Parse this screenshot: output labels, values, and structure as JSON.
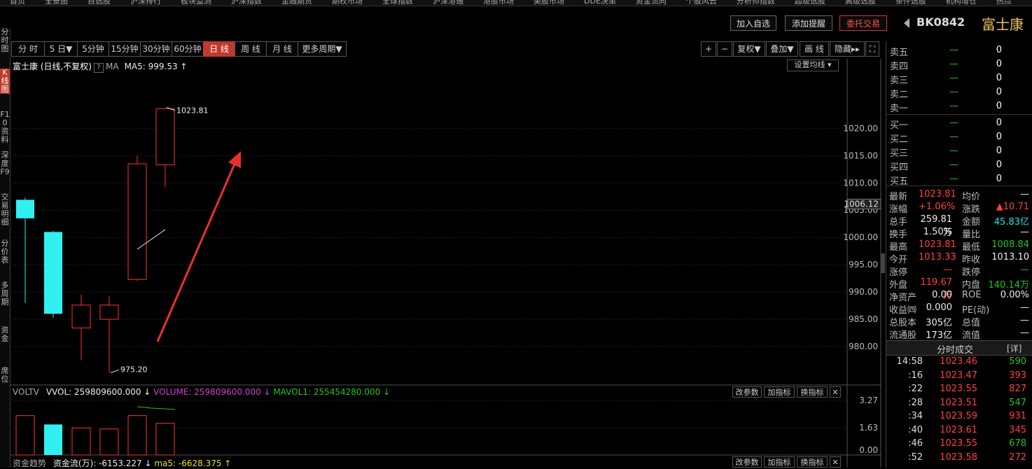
{
  "top_menu": [
    "首页",
    "全景图",
    "自选股",
    "沪深排行",
    "板块监测",
    "沪深指数",
    "金融期货",
    "期权市场",
    "全球指数",
    "沪深港通",
    "港股市场",
    "美股市场",
    "DDE决策",
    "资金流向",
    "个股风云",
    "分析师指数",
    "超级选股",
    "高级选股",
    "条件选股",
    "机构增仓",
    "热点"
  ],
  "left_tabs": [
    "分时图",
    "K线图",
    "F10资料",
    "深度F9",
    "交易明细",
    "分价表",
    "多周期",
    "资金",
    "席位"
  ],
  "header": {
    "add_watch": "加入自选",
    "add_alert": "添加提醒",
    "trade": "委托交易",
    "code": "BK0842",
    "name": "富士康"
  },
  "period_tabs": [
    "分 时",
    "5 日▼",
    "5分钟",
    "15分钟",
    "30分钟",
    "60分钟",
    "日 线",
    "周 线",
    "月 线",
    "更多周期▼"
  ],
  "active_period": "日 线",
  "right_tools": [
    "+",
    "−",
    "复权▼",
    "叠加▼",
    "画 线",
    "隐藏▸▸",
    "⛶"
  ],
  "chart_info": {
    "name": "富士康 (日线,不复权)",
    "q": "?",
    "ma_label": "MA",
    "ma5": "MA5: 999.53 ↑",
    "set_ma": "设置均线 ▾"
  },
  "chart_data": {
    "type": "candlestick",
    "y_ticks": [
      "1020.00",
      "1015.00",
      "1010.00",
      "1005.00",
      "1000.00",
      "995.00",
      "990.00",
      "985.00",
      "980.00"
    ],
    "ylim": [
      975,
      1028
    ],
    "last_price_marker": "1006.12",
    "high_label": "1023.81",
    "low_label": "975.20",
    "candles": [
      {
        "open": 1006.9,
        "high": 1007.3,
        "low": 988.0,
        "close": 1003.5
      },
      {
        "open": 1001.0,
        "high": 1001.2,
        "low": 985.3,
        "close": 986.0
      },
      {
        "open": 983.4,
        "high": 989.5,
        "low": 977.5,
        "close": 987.6
      },
      {
        "open": 985.0,
        "high": 989.2,
        "low": 975.2,
        "close": 987.6
      },
      {
        "open": 992.3,
        "high": 1015.0,
        "low": 992.0,
        "close": 1013.5
      },
      {
        "open": 1013.3,
        "high": 1023.8,
        "low": 1009.2,
        "close": 1023.6
      }
    ]
  },
  "volume": {
    "title": "VOLTV",
    "vvol": "VVOL: 259809600.000",
    "volume": "VOLUME: 259809600.000",
    "mavol": "MAVOL1: 255454280.000",
    "y_ticks": [
      "3.27",
      "1.63",
      "0.00"
    ],
    "ylim": [
      0,
      3.27
    ],
    "bars": [
      {
        "value": 2.36,
        "up": false
      },
      {
        "value": 1.83,
        "up": true
      },
      {
        "value": 1.62,
        "up": false
      },
      {
        "value": 1.56,
        "up": false
      },
      {
        "value": 2.36,
        "up": false
      },
      {
        "value": 1.9,
        "up": false
      }
    ]
  },
  "flow": {
    "title": "资金趋势",
    "label": "资金流(万): -6153.227",
    "ma5": "ma5: -6628.375 ↑"
  },
  "sub_buttons": [
    "改参数",
    "加指标",
    "换指标",
    "✕"
  ],
  "orderbook": [
    {
      "label": "卖五",
      "price": "—",
      "vol": "0"
    },
    {
      "label": "卖四",
      "price": "—",
      "vol": "0"
    },
    {
      "label": "卖三",
      "price": "—",
      "vol": "0"
    },
    {
      "label": "卖二",
      "price": "—",
      "vol": "0"
    },
    {
      "label": "卖一",
      "price": "—",
      "vol": "0"
    },
    {
      "label": "买一",
      "price": "—",
      "vol": "0"
    },
    {
      "label": "买二",
      "price": "—",
      "vol": "0"
    },
    {
      "label": "买三",
      "price": "—",
      "vol": "0"
    },
    {
      "label": "买四",
      "price": "—",
      "vol": "0"
    },
    {
      "label": "买五",
      "price": "—",
      "vol": "0"
    }
  ],
  "quote": [
    {
      "l": "最新",
      "v": "1023.81",
      "vc": "red",
      "l2": "均价",
      "v2": "—",
      "v2c": "white"
    },
    {
      "l": "涨幅",
      "v": "+1.06%",
      "vc": "red",
      "l2": "涨跌",
      "v2": "▲10.71",
      "v2c": "red"
    },
    {
      "l": "总手",
      "v": "259.81万",
      "vc": "white",
      "l2": "金额",
      "v2": "45.83亿",
      "v2c": "cyan"
    },
    {
      "l": "换手",
      "v": "1.50%",
      "vc": "white",
      "l2": "量比",
      "v2": "—",
      "v2c": "white"
    },
    {
      "l": "最高",
      "v": "1023.81",
      "vc": "red",
      "l2": "最低",
      "v2": "1008.84",
      "v2c": "green"
    },
    {
      "l": "今开",
      "v": "1013.33",
      "vc": "red",
      "l2": "昨收",
      "v2": "1013.10",
      "v2c": "white"
    },
    {
      "l": "涨停",
      "v": "—",
      "vc": "red",
      "l2": "跌停",
      "v2": "—",
      "v2c": "green"
    },
    {
      "l": "外盘",
      "v": "119.67万",
      "vc": "red",
      "l2": "内盘",
      "v2": "140.14万",
      "v2c": "green"
    },
    {
      "l": "净资产",
      "v": "0.00",
      "vc": "white",
      "l2": "ROE",
      "v2": "0.00%",
      "v2c": "white"
    },
    {
      "l": "收益㈣",
      "v": "0.000",
      "vc": "white",
      "l2": "PE(动)",
      "v2": "—",
      "v2c": "white"
    },
    {
      "l": "总股本",
      "v": "305亿",
      "vc": "white",
      "l2": "总值",
      "v2": "—",
      "v2c": "white"
    },
    {
      "l": "流通股",
      "v": "173亿",
      "vc": "white",
      "l2": "流值",
      "v2": "—",
      "v2c": "white"
    }
  ],
  "ticks": {
    "title": "分时成交",
    "detail": "[详]",
    "rows": [
      {
        "t": "14:58",
        "p": "1023.46",
        "v": "590",
        "vc": "green"
      },
      {
        "t": ":16",
        "p": "1023.47",
        "v": "393",
        "vc": "red"
      },
      {
        "t": ":22",
        "p": "1023.55",
        "v": "827",
        "vc": "red"
      },
      {
        "t": ":28",
        "p": "1023.51",
        "v": "547",
        "vc": "green"
      },
      {
        "t": ":34",
        "p": "1023.59",
        "v": "931",
        "vc": "red"
      },
      {
        "t": ":40",
        "p": "1023.61",
        "v": "345",
        "vc": "red"
      },
      {
        "t": ":46",
        "p": "1023.55",
        "v": "678",
        "vc": "green"
      },
      {
        "t": ":52",
        "p": "1023.58",
        "v": "272",
        "vc": "red"
      }
    ]
  }
}
